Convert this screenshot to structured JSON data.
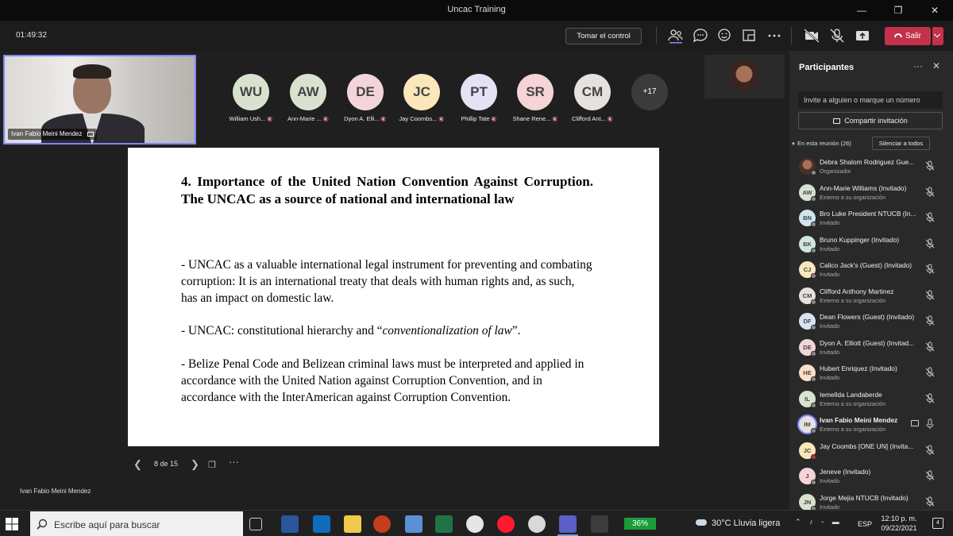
{
  "window": {
    "title": "Uncac Training"
  },
  "toolbar": {
    "timer": "01:49:32",
    "take_control": "Tomar el control",
    "leave": "Salir"
  },
  "self_video": {
    "name": "Ivan Fabio Meini Mendez"
  },
  "tiles": [
    {
      "initials": "WU",
      "label": "William Ush...",
      "color": "#d9e2cf"
    },
    {
      "initials": "AW",
      "label": "Ann-Marie ...",
      "color": "#d9e2cf"
    },
    {
      "initials": "DE",
      "label": "Dyon A. Elli...",
      "color": "#f2d5d8"
    },
    {
      "initials": "JC",
      "label": "Jay Coombs...",
      "color": "#fbe7bb"
    },
    {
      "initials": "PT",
      "label": "Phillip Tate",
      "color": "#e4e2f5"
    },
    {
      "initials": "SR",
      "label": "Shane Rene...",
      "color": "#f6d3d6"
    },
    {
      "initials": "CM",
      "label": "Clifford Ant...",
      "color": "#e4e1df"
    }
  ],
  "more_count": "+17",
  "slide": {
    "heading": "4. Importance of the United Nation Convention Against Corruption. The UNCAC as a source of national and international law",
    "bullet1": "-  UNCAC as a valuable international legal instrument for preventing and combating corruption: It is an international treaty that deals with human rights and, as such, has an impact on domestic law.",
    "bullet2_pre": "- UNCAC: constitutional hierarchy and “",
    "bullet2_em": "conventionalization of law",
    "bullet2_post": "”.",
    "bullet3": "- Belize Penal Code and Belizean criminal laws must be interpreted and applied in accordance with the United Nation against Corruption Convention, and in accordance with the InterAmerican against Corruption Convention."
  },
  "slide_nav": {
    "page": "8 de 15"
  },
  "presenter": "Ivan Fabio Meini Mendez",
  "panel": {
    "title": "Participantes",
    "invite_placeholder": "Invite a alguien o marque un número",
    "share_invite": "Compartir invitación",
    "section": "En esta reunión (26)",
    "mute_all": "Silenciar a todos",
    "participants": [
      {
        "initials": "",
        "name": "Debra Shalom Rodriguez Gue...",
        "sub": "Organizador",
        "color": "#8c6a5a",
        "photo": true
      },
      {
        "initials": "AW",
        "name": "Ann-Marie Williams (Invitado)",
        "sub": "Externo a su organización",
        "color": "#d9e2cf"
      },
      {
        "initials": "BN",
        "name": "Bro Luke President NTUCB (In...",
        "sub": "Invitado",
        "color": "#cfe4ee"
      },
      {
        "initials": "BK",
        "name": "Bruno Kuppinger (Invitado)",
        "sub": "Invitado",
        "color": "#cfe6dd"
      },
      {
        "initials": "CJ",
        "name": "Calico Jack's (Guest) (Invitado)",
        "sub": "Invitado",
        "color": "#fbe7bb"
      },
      {
        "initials": "CM",
        "name": "Clifford Anthony Martinez",
        "sub": "Externo a su organización",
        "color": "#e4e1df"
      },
      {
        "initials": "DF",
        "name": "Dean Flowers (Guest) (Invitado)",
        "sub": "Invitado",
        "color": "#d6e4f2"
      },
      {
        "initials": "DE",
        "name": "Dyon A. Elliott (Guest) (Invitad...",
        "sub": "Invitado",
        "color": "#f2d5d8"
      },
      {
        "initials": "HE",
        "name": "Hubert Enriquez (Invitado)",
        "sub": "Invitado",
        "color": "#fbe0c8"
      },
      {
        "initials": "IL",
        "name": "Iemellda Landaberde",
        "sub": "Externo a su organización",
        "color": "#d9e2cf"
      },
      {
        "initials": "IM",
        "name": "Ivan Fabio Meini Mendez",
        "sub": "Externo a su organización",
        "color": "#e4e1df",
        "active": true
      },
      {
        "initials": "JC",
        "name": "Jay Coombs [ONE UN] (Invita...",
        "sub": "",
        "color": "#fbe7bb"
      },
      {
        "initials": "J",
        "name": "Jeneve (Invitado)",
        "sub": "Invitado",
        "color": "#f6d3d6"
      },
      {
        "initials": "JN",
        "name": "Jorge Mejia NTUCB (Invitado)",
        "sub": "Invitado",
        "color": "#d9e2cf"
      }
    ]
  },
  "taskbar": {
    "search": "Escribe aquí para buscar",
    "battery": "36%",
    "weather": "30°C  Lluvia ligera",
    "lang": "ESP",
    "time": "12:10 p. m.",
    "date": "09/22/2021",
    "notif": "4"
  }
}
